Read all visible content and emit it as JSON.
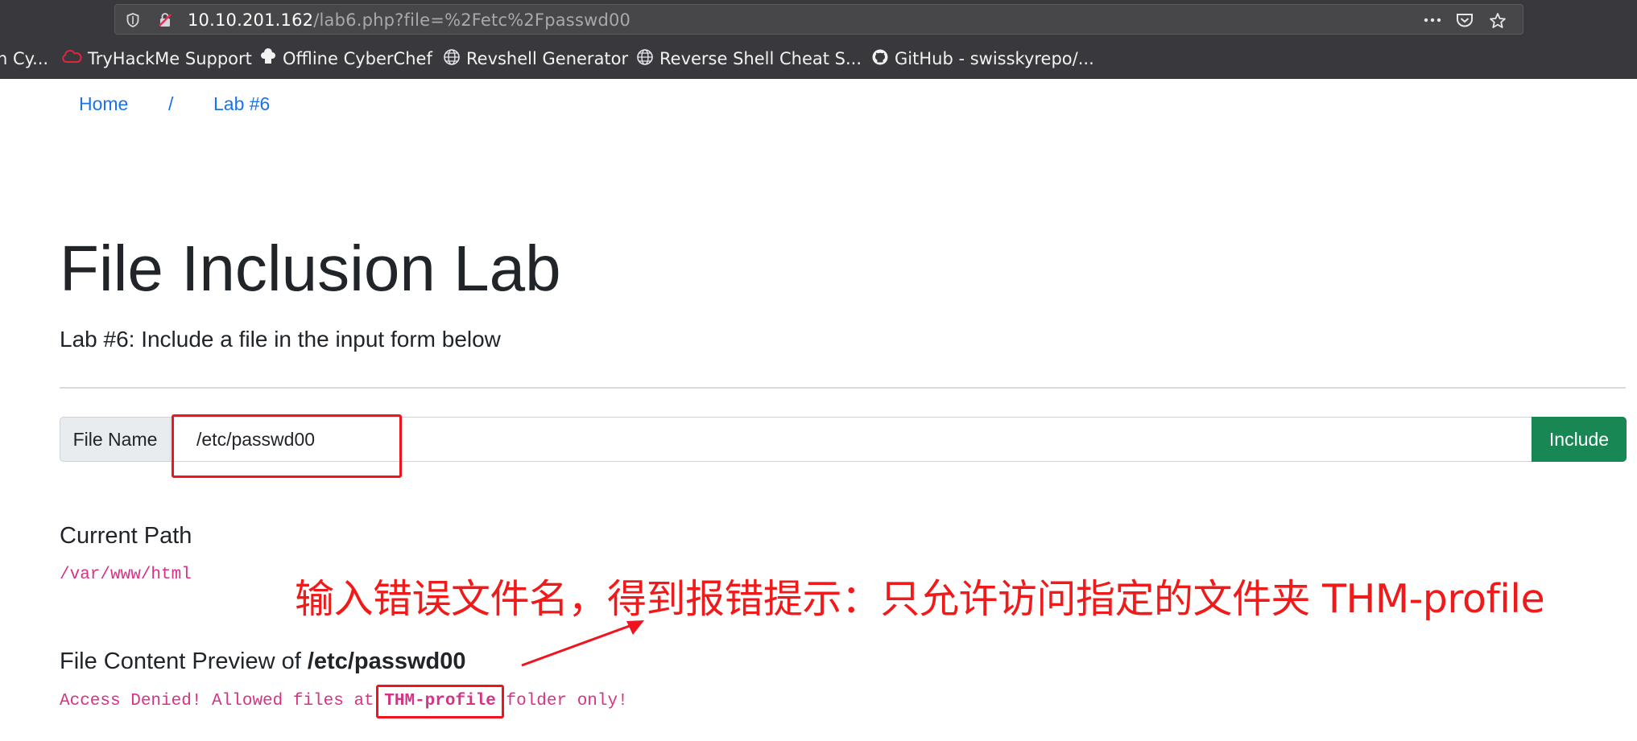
{
  "browser": {
    "url_host": "10.10.201.162",
    "url_path": "/lab6.php?file=%2Fetc%2Fpasswd00",
    "icons": [
      "shield-icon",
      "insecure-lock-icon",
      "more-options-icon",
      "pocket-icon",
      "bookmark-star-icon"
    ],
    "bookmarks": [
      {
        "label": "n Cy...",
        "icon": "none"
      },
      {
        "label": "TryHackMe Support",
        "icon": "tryhackme-cloud-icon"
      },
      {
        "label": "Offline CyberChef",
        "icon": "chef-hat-icon"
      },
      {
        "label": "Revshell Generator",
        "icon": "globe-icon"
      },
      {
        "label": "Reverse Shell Cheat S...",
        "icon": "globe-icon"
      },
      {
        "label": "GitHub - swisskyrepo/...",
        "icon": "github-icon"
      }
    ]
  },
  "breadcrumb": {
    "home": "Home",
    "separator": "/",
    "current": "Lab #6"
  },
  "page": {
    "title": "File Inclusion Lab",
    "subtitle": "Lab #6: Include a file in the input form below"
  },
  "form": {
    "label": "File Name",
    "value": "/etc/passwd00",
    "button": "Include"
  },
  "path_section": {
    "heading": "Current Path",
    "value": "/var/www/html"
  },
  "preview": {
    "heading_prefix": "File Content Preview of ",
    "heading_file": "/etc/passwd00",
    "msg_before": "Access Denied! Allowed files at ",
    "msg_highlight": "THM-profile",
    "msg_after": " folder only!"
  },
  "annotation": {
    "text": "输入错误文件名，得到报错提示：只允许访问指定的文件夹 THM-profile",
    "color": "#f0141e"
  },
  "colors": {
    "accent_link": "#1a73e8",
    "code": "#d63384",
    "button": "#198754",
    "annotation": "#f0141e"
  }
}
